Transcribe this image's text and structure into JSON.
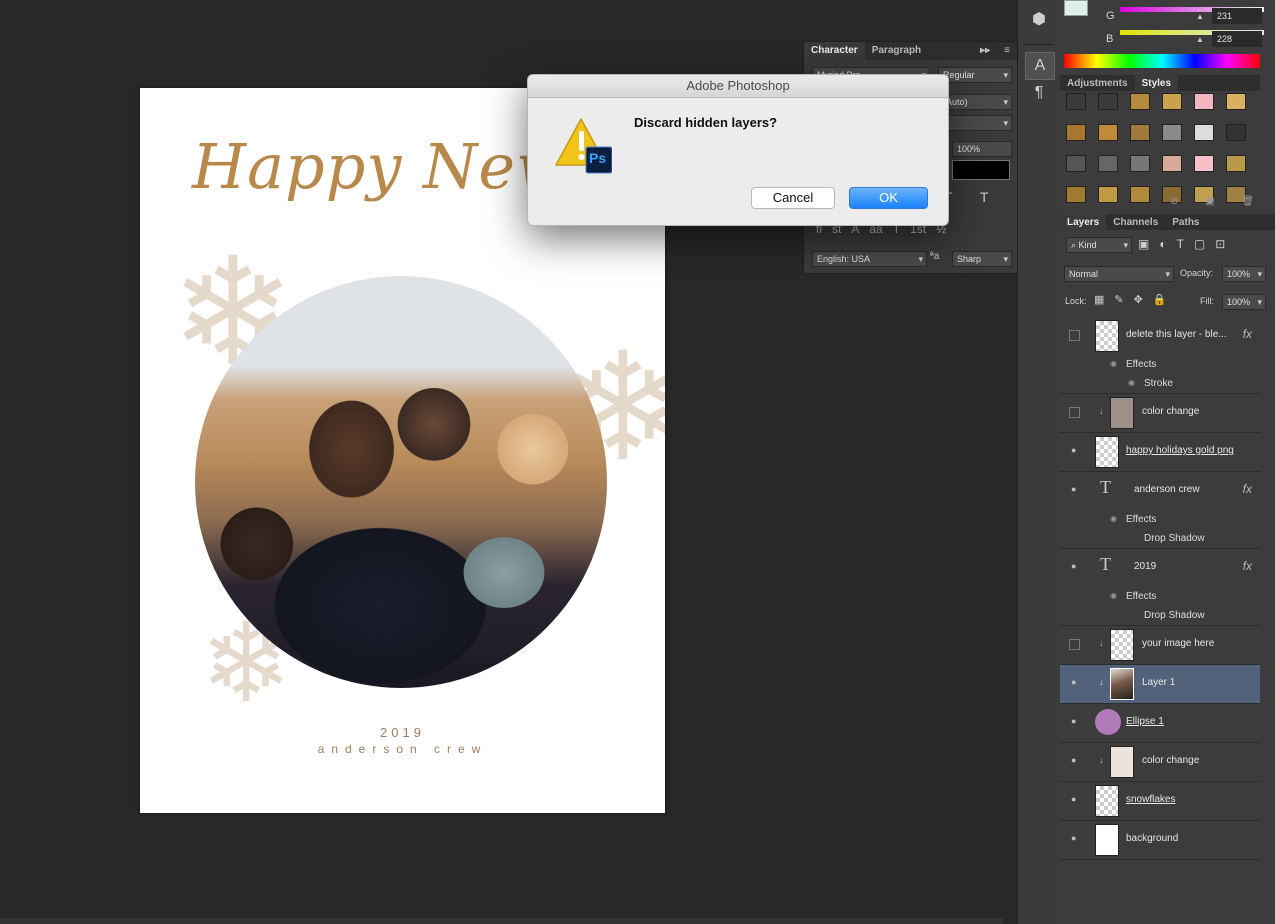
{
  "dialog": {
    "title": "Adobe Photoshop",
    "message": "Discard hidden layers?",
    "icon_badge": "Ps",
    "cancel_label": "Cancel",
    "ok_label": "OK"
  },
  "document": {
    "title_text": "Happy New Y",
    "year": "2019",
    "name": "anderson crew"
  },
  "color_panel": {
    "g_label": "G",
    "g_value": "231",
    "b_label": "B",
    "b_value": "228"
  },
  "adjustments_panel": {
    "tabs": [
      "Adjustments",
      "Styles"
    ],
    "active_tab": "Styles"
  },
  "character_panel": {
    "tabs": [
      "Character",
      "Paragraph"
    ],
    "font_family": "Myriad Pro",
    "font_style": "Regular",
    "leading": "(Auto)",
    "scale_value": "100%",
    "language": "English: USA",
    "aa_label": "ªa",
    "antialias": "Sharp",
    "typo_buttons": [
      "fi",
      "st",
      "A",
      "aa",
      "T",
      "1st",
      "½"
    ]
  },
  "layers_panel": {
    "tabs": [
      "Layers",
      "Channels",
      "Paths"
    ],
    "filter_kind": "Kind",
    "blend_mode": "Normal",
    "opacity_label": "Opacity:",
    "opacity_value": "100%",
    "lock_label": "Lock:",
    "fill_label": "Fill:",
    "fill_value": "100%",
    "effects_label": "Effects",
    "stroke_label": "Stroke",
    "drop_shadow_label": "Drop Shadow",
    "layers": [
      {
        "name": "delete this layer - ble...",
        "visible": false,
        "fx": true
      },
      {
        "name": "color change",
        "visible": false
      },
      {
        "name": "happy holidays gold png",
        "visible": true
      },
      {
        "name": "anderson crew",
        "visible": true,
        "fx": true
      },
      {
        "name": "2019",
        "visible": true,
        "fx": true
      },
      {
        "name": "your image here",
        "visible": false
      },
      {
        "name": "Layer 1",
        "visible": true,
        "selected": true
      },
      {
        "name": "Ellipse 1",
        "visible": true
      },
      {
        "name": "color change",
        "visible": true
      },
      {
        "name": "snowflakes",
        "visible": true
      },
      {
        "name": "background",
        "visible": true
      }
    ]
  },
  "colors": {
    "accent_blue": "#1a82fb",
    "gold": "#b8894a",
    "selected_layer": "#52627a"
  }
}
